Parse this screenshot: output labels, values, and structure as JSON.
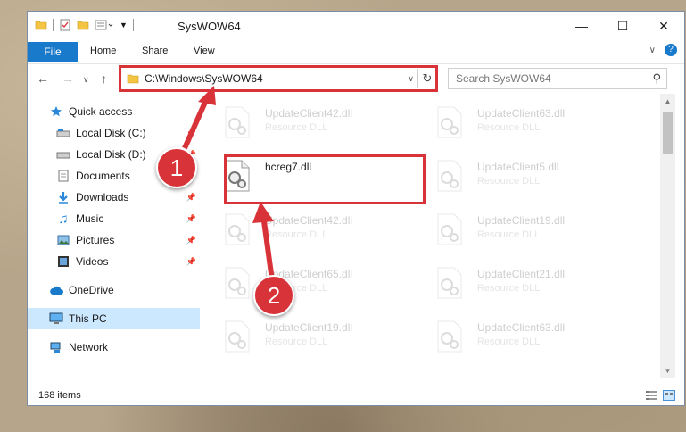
{
  "window": {
    "title": "SysWOW64"
  },
  "ribbon": {
    "tabs": [
      "File",
      "Home",
      "Share",
      "View"
    ]
  },
  "navigation": {
    "address": "C:\\Windows\\SysWOW64",
    "search_placeholder": "Search SysWOW64"
  },
  "sidebar": {
    "items": [
      {
        "label": "Quick access",
        "icon": "star-icon",
        "pinned": false
      },
      {
        "label": "Local Disk (C:)",
        "icon": "drive-icon",
        "pinned": true
      },
      {
        "label": "Local Disk (D:)",
        "icon": "drive-icon",
        "pinned": true
      },
      {
        "label": "Documents",
        "icon": "documents-icon",
        "pinned": true
      },
      {
        "label": "Downloads",
        "icon": "download-icon",
        "pinned": true
      },
      {
        "label": "Music",
        "icon": "music-icon",
        "pinned": true
      },
      {
        "label": "Pictures",
        "icon": "pictures-icon",
        "pinned": true
      },
      {
        "label": "Videos",
        "icon": "videos-icon",
        "pinned": true
      },
      {
        "label": "OneDrive",
        "icon": "cloud-icon",
        "pinned": false
      },
      {
        "label": "This PC",
        "icon": "computer-icon",
        "pinned": false,
        "selected": true
      },
      {
        "label": "Network",
        "icon": "network-icon",
        "pinned": false
      }
    ]
  },
  "files": {
    "highlighted": {
      "name": "hcreg7.dll"
    },
    "left": [
      {
        "name": "UpdateClient42.dll",
        "type": "Resource DLL"
      },
      {
        "name": "UpdateClient42.dll",
        "type": "Resource DLL"
      },
      {
        "name": "UpdateClient65.dll",
        "type": "Resource DLL"
      },
      {
        "name": "UpdateClient19.dll",
        "type": "Resource DLL"
      }
    ],
    "right": [
      {
        "name": "UpdateClient63.dll",
        "type": "Resource DLL"
      },
      {
        "name": "UpdateClient5.dll",
        "type": "Resource DLL"
      },
      {
        "name": "UpdateClient19.dll",
        "type": "Resource DLL"
      },
      {
        "name": "UpdateClient21.dll",
        "type": "Resource DLL"
      },
      {
        "name": "UpdateClient63.dll",
        "type": "Resource DLL"
      }
    ]
  },
  "status": {
    "item_count": "168 items"
  },
  "callouts": [
    "1",
    "2"
  ],
  "colors": {
    "accent": "#1979ca",
    "highlight": "#d9333a",
    "selected": "#cce8ff"
  }
}
